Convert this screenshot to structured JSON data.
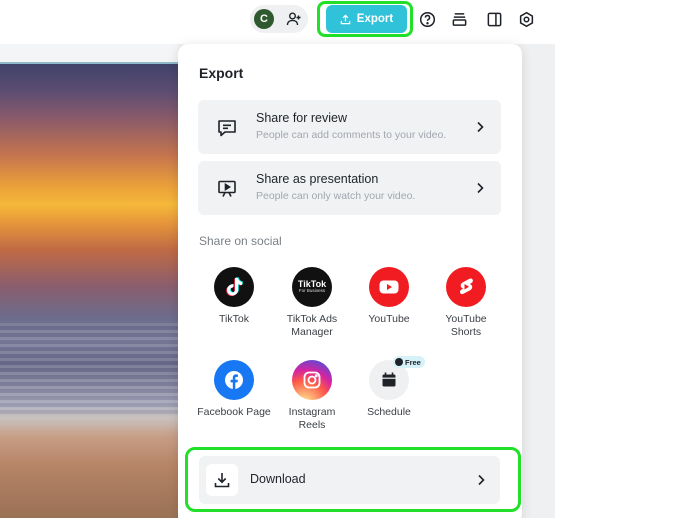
{
  "topbar": {
    "avatar_initial": "C",
    "export_label": "Export",
    "icons": [
      "add-user-icon",
      "help-icon",
      "layers-icon",
      "layout-icon",
      "settings-icon"
    ]
  },
  "panel": {
    "title": "Export",
    "share_options": [
      {
        "title": "Share for review",
        "subtitle": "People can add comments to your video.",
        "icon": "comment-icon"
      },
      {
        "title": "Share as presentation",
        "subtitle": "People can only watch your video.",
        "icon": "presentation-icon"
      }
    ],
    "social_heading": "Share on social",
    "social": [
      {
        "label": "TikTok",
        "icon": "tiktok-icon",
        "color": "#111111"
      },
      {
        "label": "TikTok Ads Manager",
        "icon": "tiktok-business-icon",
        "color": "#111111",
        "logo_text": "TikTok",
        "logo_sub": "For Business"
      },
      {
        "label": "YouTube",
        "icon": "youtube-icon",
        "color": "#f01c22"
      },
      {
        "label": "YouTube Shorts",
        "icon": "youtube-shorts-icon",
        "color": "#f01c22"
      },
      {
        "label": "Facebook Page",
        "icon": "facebook-icon",
        "color": "#1877f2"
      },
      {
        "label": "Instagram Reels",
        "icon": "instagram-icon",
        "color": "#d6249f"
      },
      {
        "label": "Schedule",
        "icon": "calendar-icon",
        "color": "#eef0f2",
        "badge": "Free"
      }
    ],
    "download_label": "Download"
  },
  "colors": {
    "accent": "#2fc2d9",
    "highlight": "#22e02a"
  }
}
